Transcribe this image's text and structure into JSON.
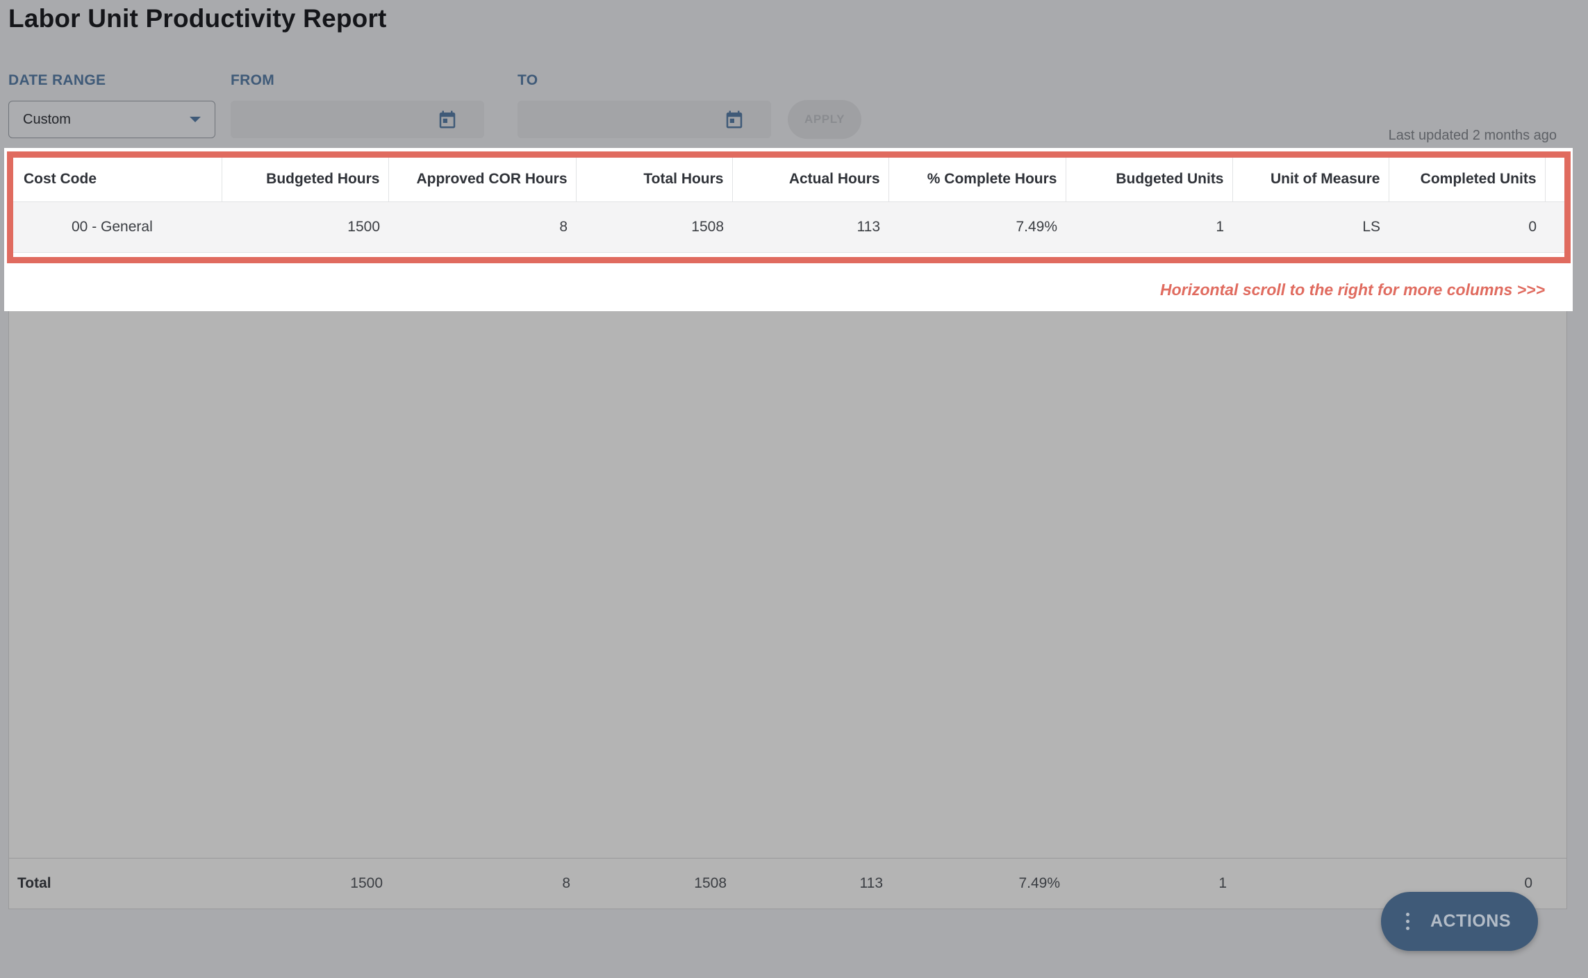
{
  "header": {
    "title": "Labor Unit Productivity Report"
  },
  "filters": {
    "date_range_label": "DATE RANGE",
    "date_range_value": "Custom",
    "from_label": "FROM",
    "from_value": "",
    "to_label": "TO",
    "to_value": "",
    "apply_label": "APPLY"
  },
  "status": {
    "last_updated": "Last updated 2 months ago"
  },
  "table": {
    "columns": [
      "Cost Code",
      "Budgeted Hours",
      "Approved COR Hours",
      "Total Hours",
      "Actual Hours",
      "% Complete Hours",
      "Budgeted Units",
      "Unit of Measure",
      "Completed Units"
    ],
    "rows": [
      [
        "00 - General",
        "1500",
        "8",
        "1508",
        "113",
        "7.49%",
        "1",
        "LS",
        "0"
      ]
    ],
    "total": [
      "Total",
      "1500",
      "8",
      "1508",
      "113",
      "7.49%",
      "1",
      "",
      "0"
    ]
  },
  "annotation": {
    "scroll_hint": "Horizontal scroll to the right for more columns >>>"
  },
  "actions": {
    "label": "ACTIONS"
  },
  "icons": {
    "calendar": "calendar-icon",
    "dropdown": "chevron-down-icon",
    "actions": "kebab-icon"
  },
  "colors": {
    "accent": "#3f5a78",
    "highlight": "#e06b5f",
    "overlay": "#a9aaad"
  }
}
